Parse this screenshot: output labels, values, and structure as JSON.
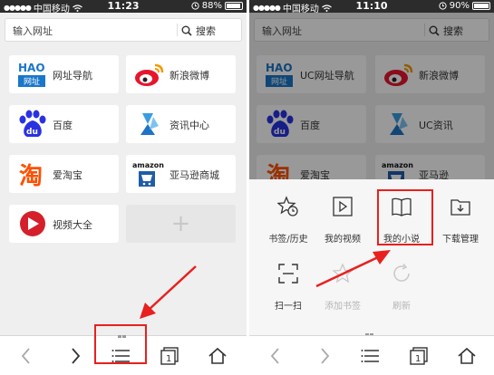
{
  "accent": "#e8201e",
  "left_screen": {
    "status": {
      "carrier": "中国移动",
      "time": "11:23",
      "battery": "88%",
      "battery_level": 0.88
    },
    "search": {
      "placeholder": "输入网址",
      "button": "搜索"
    },
    "tiles": [
      {
        "label": "网址导航",
        "icon": "hao-nav-icon",
        "logo_text_top": "HAO",
        "logo_text_bottom": "网址"
      },
      {
        "label": "新浪微博",
        "icon": "weibo-icon"
      },
      {
        "label": "百度",
        "icon": "baidu-icon",
        "logo_text": "du"
      },
      {
        "label": "资讯中心",
        "icon": "news-center-icon"
      },
      {
        "label": "爱淘宝",
        "icon": "taobao-icon",
        "logo_text": "淘"
      },
      {
        "label": "亚马逊商城",
        "icon": "amazon-icon",
        "logo_text": "amazon"
      },
      {
        "label": "视频大全",
        "icon": "video-icon"
      }
    ],
    "add_tile": "+",
    "toolbar": [
      "back-icon",
      "forward-icon",
      "menu-icon",
      "tabs-icon",
      "home-icon"
    ],
    "tab_count": "1"
  },
  "right_screen": {
    "status": {
      "carrier": "中国移动",
      "time": "11:10",
      "battery": "90%",
      "battery_level": 0.9
    },
    "search": {
      "placeholder": "输入网址",
      "button": "搜索"
    },
    "tiles": [
      {
        "label": "UC网址导航",
        "icon": "hao-nav-icon",
        "logo_text_top": "HAO",
        "logo_text_bottom": "网址"
      },
      {
        "label": "新浪微博",
        "icon": "weibo-icon"
      },
      {
        "label": "百度",
        "icon": "baidu-icon",
        "logo_text": "du"
      },
      {
        "label": "UC资讯",
        "icon": "news-center-icon"
      },
      {
        "label": "爱淘宝",
        "icon": "taobao-icon",
        "logo_text": "淘"
      },
      {
        "label": "亚马逊",
        "icon": "amazon-icon",
        "logo_text": "amazon"
      }
    ],
    "menu": [
      {
        "label": "书签/历史",
        "icon": "bookmark-history-icon",
        "enabled": true
      },
      {
        "label": "我的视频",
        "icon": "my-video-icon",
        "enabled": true
      },
      {
        "label": "我的小说",
        "icon": "my-novel-icon",
        "enabled": true
      },
      {
        "label": "下载管理",
        "icon": "download-icon",
        "enabled": true
      },
      {
        "label": "扫一扫",
        "icon": "scan-icon",
        "enabled": true
      },
      {
        "label": "添加书签",
        "icon": "add-bookmark-icon",
        "enabled": false
      },
      {
        "label": "刷新",
        "icon": "refresh-icon",
        "enabled": false
      }
    ],
    "toolbar": [
      "back-icon",
      "forward-icon",
      "menu-icon",
      "tabs-icon",
      "home-icon"
    ],
    "tab_count": "1"
  }
}
